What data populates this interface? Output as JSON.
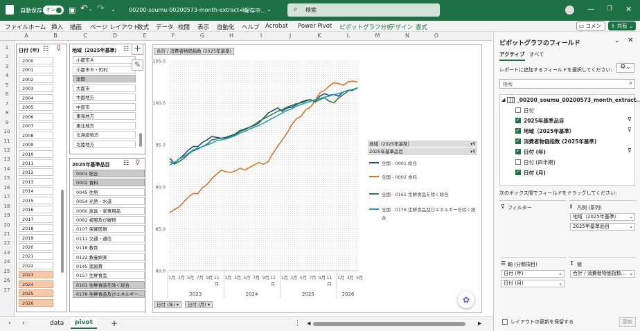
{
  "titlebar": {
    "autosave": "自動保存",
    "toggle": "オン",
    "filename": "00200-soumu-00200573-month-extract-lis···",
    "saving": "• 保存中…",
    "search": "検索"
  },
  "ribbon_tabs": [
    "ファイル",
    "ホーム",
    "挿入",
    "描画",
    "ページ レイアウト",
    "数式",
    "データ",
    "校閲",
    "表示",
    "自動化",
    "ヘルプ",
    "Acrobat",
    "Power Pivot",
    "ピボットグラフ分析",
    "デザイン",
    "書式"
  ],
  "ribbon_actions": {
    "comment": "コメント",
    "share": "共有"
  },
  "columns": [
    "A",
    "B",
    "C",
    "D",
    "E",
    "F",
    "G",
    "H",
    "I",
    "J",
    "K",
    "L",
    "M",
    "N",
    "O"
  ],
  "rows": [
    "1",
    "2",
    "3",
    "4",
    "5",
    "6",
    "7",
    "8",
    "9",
    "10",
    "11",
    "12",
    "13",
    "14",
    "15",
    "16",
    "17",
    "18",
    "19",
    "20",
    "21",
    "22",
    "23",
    "24",
    "25",
    "26",
    "27"
  ],
  "slicer_year": {
    "title": "日付 (年)",
    "items": [
      "2000",
      "2001",
      "2002",
      "2003",
      "2004",
      "2005",
      "2006",
      "2007",
      "2008",
      "2009",
      "2010",
      "2011",
      "2012",
      "2013",
      "2014",
      "2015",
      "2016",
      "2017",
      "2018",
      "2019",
      "2020",
      "2021",
      "2022",
      "2023",
      "2024",
      "2025",
      "2026"
    ]
  },
  "slicer_region": {
    "title": "地域（2025年基準）",
    "items": [
      "小都市Ａ",
      "小都市Ｂ・町村",
      "全国",
      "大都市",
      "中国地方",
      "中部市",
      "東海地方",
      "東北地方",
      "北海道地方",
      "北陸地方"
    ]
  },
  "slicer_item": {
    "title": "2025年基準品目",
    "items": [
      "0001 総合",
      "0002 食料",
      "0045 住居",
      "0054 光熱・水道",
      "0060 家具・家事用品",
      "0082 被服及び履物",
      "0107 保健医療",
      "0111 交通・通信",
      "0118 教育",
      "0122 教養娯楽",
      "0145 諸雑費",
      "0157 生鮮食品",
      "0161 生鮮食品を除く総合",
      "0178 生鮮食品及びエネルギー..."
    ]
  },
  "chart": {
    "value_field_button": "合計 / 消費者物価指数 (2025年基準)",
    "axis_button_1": "日付 (年)",
    "axis_button_2": "日付 (月)",
    "legend_header_1": "地域（2025年基準）",
    "legend_header_2": "2025年基準品目"
  },
  "chart_data": {
    "type": "line",
    "ylim": [
      80,
      105
    ],
    "y_ticks": [
      "105.0",
      "100.0",
      "95.0",
      "90.0",
      "85.0",
      "80.0"
    ],
    "month_ticks": [
      "1",
      "月",
      "3",
      "月",
      "5",
      "月",
      "7",
      "月",
      "9",
      "月",
      "11",
      "月"
    ],
    "years": [
      "2023",
      "2024",
      "2025",
      "2026"
    ],
    "series": [
      {
        "name": "全国 - 0001 総合",
        "color": "#1f4e79",
        "values": [
          93.4,
          92.8,
          93.3,
          93.8,
          94.4,
          94.8,
          94.8,
          95.3,
          95.6,
          96.0,
          95.9,
          95.8,
          95.9,
          96.1,
          96.3,
          96.7,
          96.9,
          97.1,
          97.3,
          97.6,
          98.2,
          98.8,
          99.1,
          99.4,
          99.0,
          99.4,
          99.5,
          99.8,
          100.1,
          100.3,
          100.4,
          100.2,
          100.8,
          101.1,
          100.9,
          101.0,
          100.8,
          101.3,
          101.5,
          101.5,
          101.8
        ]
      },
      {
        "name": "全国 - 0002 食料",
        "color": "#e07020",
        "values": [
          86.9,
          87.3,
          87.6,
          88.2,
          88.8,
          89.2,
          89.2,
          89.9,
          90.3,
          91.0,
          91.5,
          92.0,
          91.8,
          91.7,
          91.9,
          92.2,
          92.0,
          92.3,
          92.6,
          92.9,
          92.7,
          93.0,
          94.0,
          94.8,
          95.6,
          96.4,
          97.4,
          98.1,
          98.4,
          99.2,
          99.5,
          100.3,
          101.2,
          101.5,
          102.0,
          102.4,
          102.3,
          102.1,
          102.5,
          102.6,
          102.5
        ]
      },
      {
        "name": "全国 - 0161 生鮮食品を除く総合",
        "color": "#2e7d32",
        "values": [
          93.0,
          92.7,
          93.0,
          93.4,
          93.9,
          94.3,
          94.5,
          94.8,
          95.1,
          95.6,
          95.7,
          95.8,
          95.8,
          96.0,
          96.2,
          96.6,
          96.8,
          97.1,
          97.4,
          97.8,
          98.1,
          98.4,
          98.7,
          99.0,
          99.2,
          99.5,
          99.7,
          99.9,
          100.0,
          100.2,
          100.4,
          100.1,
          100.4,
          100.6,
          100.2,
          100.0,
          100.6,
          101.0,
          101.4,
          101.6,
          101.7
        ]
      },
      {
        "name": "全国 - 0178 生鮮食品及びエネルギーを除く総合",
        "color": "#1f9bd7",
        "values": [
          92.6,
          92.9,
          93.3,
          93.6,
          94.0,
          94.4,
          94.6,
          94.8,
          95.0,
          95.2,
          95.5,
          95.6,
          95.7,
          95.9,
          96.1,
          96.4,
          96.6,
          96.9,
          97.1,
          97.3,
          97.6,
          97.9,
          98.2,
          98.5,
          98.8,
          99.1,
          99.3,
          99.6,
          99.8,
          100.0,
          100.2,
          100.4,
          100.5,
          100.7,
          100.8,
          101.0,
          101.1,
          101.3,
          101.5,
          101.6,
          101.8
        ]
      }
    ]
  },
  "pane": {
    "title": "ピボットグラフのフィールド",
    "tab_active": "アクティブ",
    "tab_all": "すべて",
    "instruction": "レポートに追加するフィールドを選択してください:",
    "search_placeholder": "検索",
    "table_name": "_00200_soumu_00200573_month_extract...",
    "fields": [
      {
        "label": "日付",
        "checked": false,
        "bold": false,
        "filter": false
      },
      {
        "label": "2025年基準品目",
        "checked": true,
        "bold": true,
        "filter": true
      },
      {
        "label": "地域（2025年基準）",
        "checked": true,
        "bold": true,
        "filter": true
      },
      {
        "label": "消費者物価指数 (2025年基準)",
        "checked": true,
        "bold": true,
        "filter": false
      },
      {
        "label": "日付 (年)",
        "checked": true,
        "bold": true,
        "filter": true
      },
      {
        "label": "日付 (四半期)",
        "checked": false,
        "bold": false,
        "filter": false
      },
      {
        "label": "日付 (月)",
        "checked": true,
        "bold": true,
        "filter": false
      }
    ],
    "drag_hint": "次のボックス間でフィールドをドラッグしてください:",
    "filters_label": "フィルター",
    "legend_label": "凡例 (系列)",
    "legend_items": [
      "地域（2025年基準）",
      "2025年基準品目"
    ],
    "axis_label": "軸 (分類項目)",
    "axis_items": [
      "日付 (年)",
      "日付 (月)"
    ],
    "values_label": "値",
    "values_items": [
      "合計 / 消費者物価指数..."
    ],
    "defer": "レイアウトの更新を保留する",
    "update": "更新"
  },
  "sheets": [
    "data",
    "pivot"
  ],
  "active_sheet": "pivot"
}
